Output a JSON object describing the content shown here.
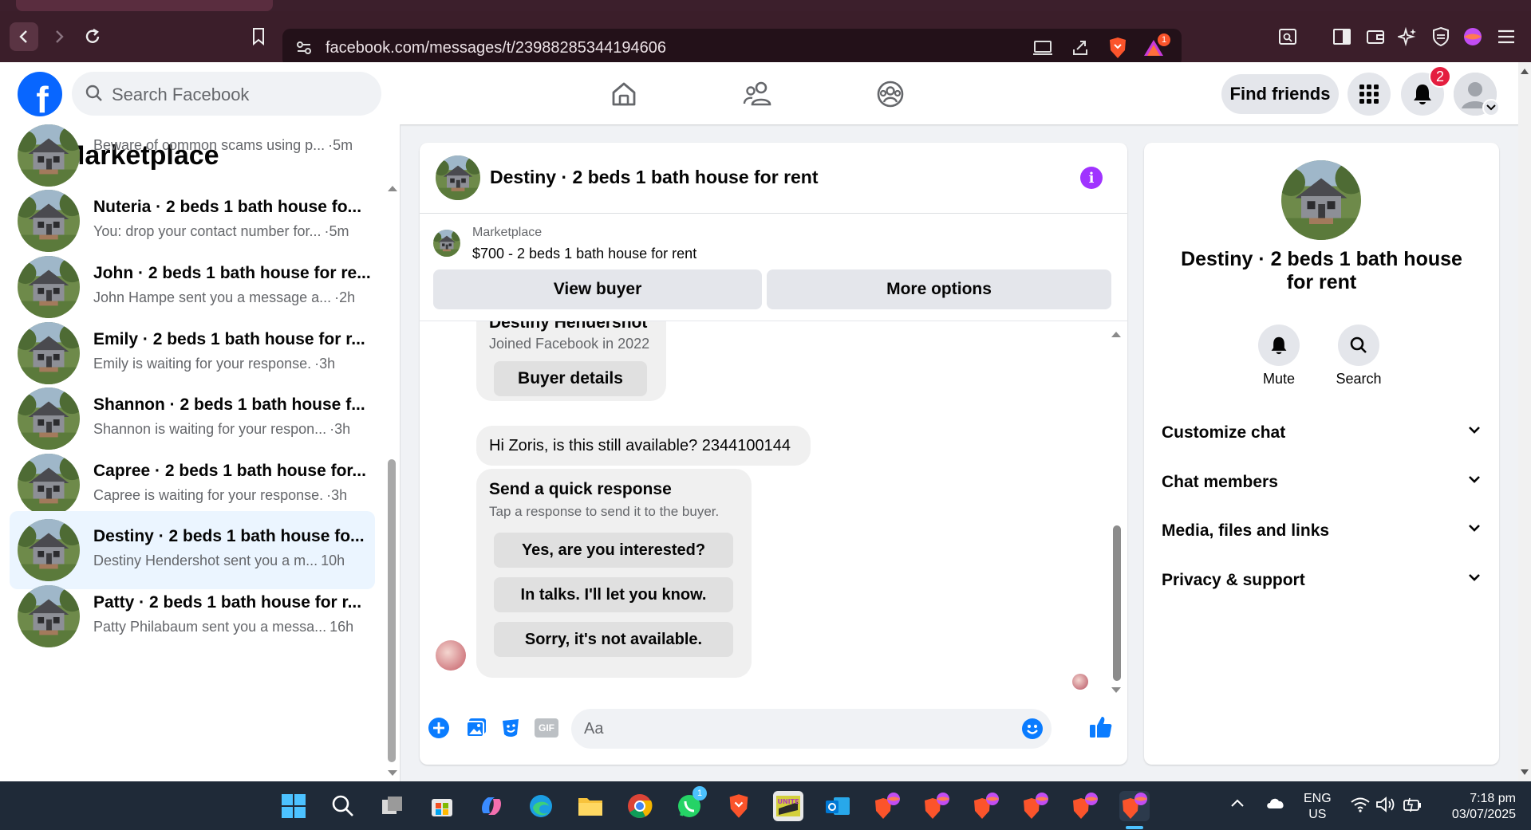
{
  "browser": {
    "url": "facebook.com/messages/t/23988285344194606",
    "shield_badge": "1"
  },
  "header": {
    "search_placeholder": "Search Facebook",
    "find_friends": "Find friends",
    "notification_count": "2"
  },
  "sidebar": {
    "title": "Marketplace",
    "conversations": [
      {
        "title": "",
        "subtitle": "Beware of common scams using p...",
        "time": "·5m"
      },
      {
        "title": "Nuteria · 2 beds 1 bath house fo...",
        "subtitle": "You: drop your contact number for...",
        "time": "·5m"
      },
      {
        "title": "John · 2 beds 1 bath house for re...",
        "subtitle": "John Hampe sent you a message a...",
        "time": "·2h"
      },
      {
        "title": "Emily · 2 beds 1 bath house for r...",
        "subtitle": "Emily is waiting for your response.",
        "time": "·3h"
      },
      {
        "title": "Shannon · 2 beds 1 bath house f...",
        "subtitle": "Shannon is waiting for your respon...",
        "time": "·3h"
      },
      {
        "title": "Capree · 2 beds 1 bath house for...",
        "subtitle": "Capree is waiting for your response.",
        "time": "·3h"
      },
      {
        "title": "Destiny · 2 beds 1 bath house fo...",
        "subtitle": "Destiny Hendershot sent you a m...",
        "time": "10h"
      },
      {
        "title": "Patty · 2 beds 1 bath house for r...",
        "subtitle": "Patty Philabaum sent you a messa...",
        "time": "16h"
      }
    ]
  },
  "chat": {
    "title": "Destiny · 2 beds 1 bath house for rent",
    "listing_source": "Marketplace",
    "listing_price": "$700 - 2 beds 1 bath house for rent",
    "view_buyer": "View buyer",
    "more_options": "More options",
    "buyer_name": "Destiny Hendershot",
    "buyer_joined": "Joined Facebook in 2022",
    "buyer_details": "Buyer details",
    "message": "Hi Zoris, is this still available? 2344100144",
    "quick_title": "Send a quick response",
    "quick_sub": "Tap a response to send it to the buyer.",
    "quick_responses": [
      "Yes, are you interested?",
      "In talks. I'll let you know.",
      "Sorry, it's not available."
    ],
    "input_placeholder": "Aa"
  },
  "right_panel": {
    "name": "Destiny · 2 beds 1 bath house for rent",
    "mute": "Mute",
    "search": "Search",
    "sections": [
      "Customize chat",
      "Chat members",
      "Media, files and links",
      "Privacy & support"
    ]
  },
  "taskbar": {
    "lang1": "ENG",
    "lang2": "US",
    "time": "7:18 pm",
    "date": "03/07/2025",
    "whatsapp_badge": "1"
  },
  "colors": {
    "fb_blue": "#0866ff",
    "messenger_blue": "#0a7cff",
    "info_purple": "#a033ff",
    "browser_bg": "#3b1e2a",
    "active_row": "#ebf5ff"
  }
}
